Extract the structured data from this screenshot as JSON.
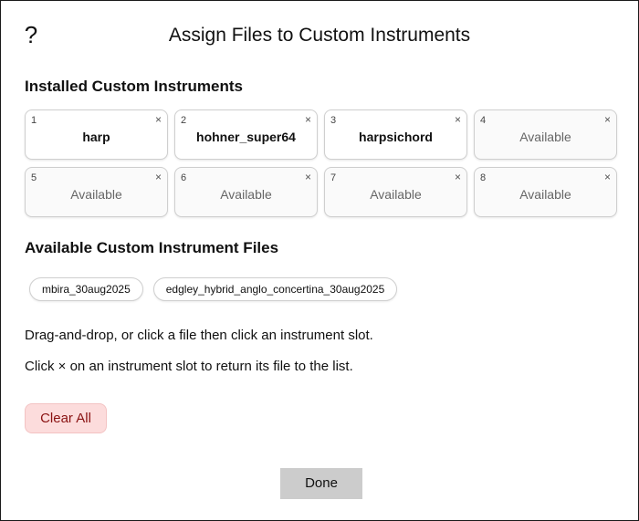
{
  "dialog": {
    "help_label": "?",
    "title": "Assign Files to Custom Instruments"
  },
  "installed": {
    "heading": "Installed Custom Instruments",
    "close_glyph": "×",
    "slots": [
      {
        "number": "1",
        "label": "harp",
        "state": "filled"
      },
      {
        "number": "2",
        "label": "hohner_super64",
        "state": "filled"
      },
      {
        "number": "3",
        "label": "harpsichord",
        "state": "filled"
      },
      {
        "number": "4",
        "label": "Available",
        "state": "empty"
      },
      {
        "number": "5",
        "label": "Available",
        "state": "empty"
      },
      {
        "number": "6",
        "label": "Available",
        "state": "empty"
      },
      {
        "number": "7",
        "label": "Available",
        "state": "empty"
      },
      {
        "number": "8",
        "label": "Available",
        "state": "empty"
      }
    ]
  },
  "available": {
    "heading": "Available Custom Instrument Files",
    "files": [
      "mbira_30aug2025",
      "edgley_hybrid_anglo_concertina_30aug2025"
    ]
  },
  "instructions": {
    "line1": "Drag-and-drop, or click a file then click an instrument slot.",
    "line2": "Click × on an instrument slot to return its file to the list."
  },
  "buttons": {
    "clear_all": "Clear All",
    "done": "Done"
  },
  "colors": {
    "clear_bg": "#fcdcdc",
    "clear_text": "#8a1212",
    "done_bg": "#cccccc"
  }
}
